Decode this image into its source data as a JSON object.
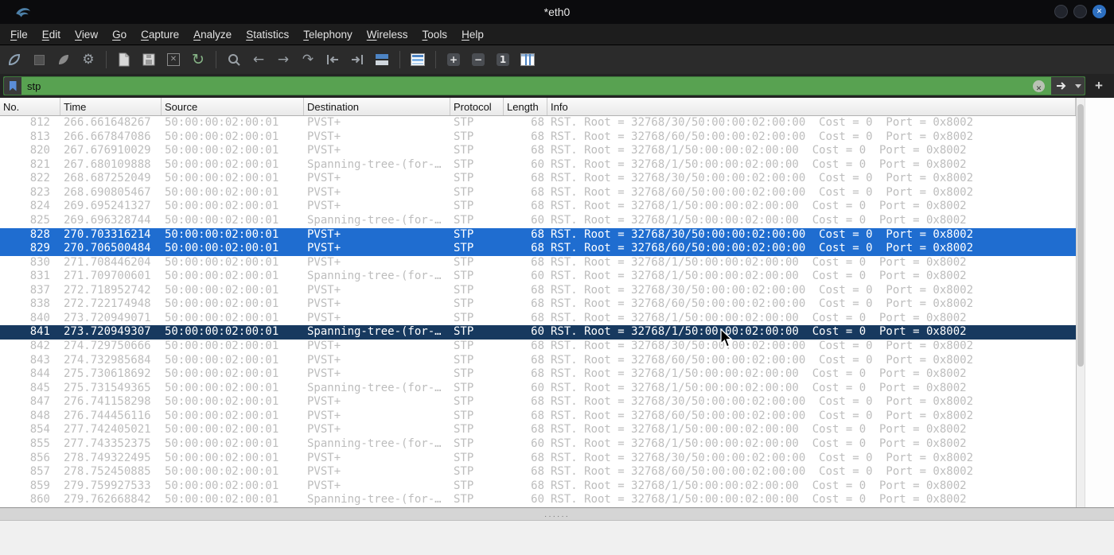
{
  "window": {
    "title": "*eth0"
  },
  "menubar": {
    "items": [
      "File",
      "Edit",
      "View",
      "Go",
      "Capture",
      "Analyze",
      "Statistics",
      "Telephony",
      "Wireless",
      "Tools",
      "Help"
    ]
  },
  "toolbar": {
    "groups": [
      [
        "wireshark-fin",
        "stop-capture",
        "restart-capture",
        "capture-options"
      ],
      [
        "open-file",
        "save-file",
        "close-file",
        "reload-file"
      ],
      [
        "find-packet",
        "go-back",
        "go-forward",
        "go-to-packet",
        "go-first",
        "go-last",
        "auto-scroll"
      ],
      [
        "colorize"
      ],
      [
        "zoom-in",
        "zoom-out",
        "zoom-100",
        "resize-columns"
      ]
    ]
  },
  "filter": {
    "value": "stp",
    "add_label": "+"
  },
  "colors": {
    "filter_valid_green": "#58a251",
    "row_highlight_blue": "#1f6dd0",
    "row_selected_navy": "#17395f",
    "row_text_gray": "#bdbdbd"
  },
  "table": {
    "columns": [
      "No.",
      "Time",
      "Source",
      "Destination",
      "Protocol",
      "Length",
      "Info"
    ],
    "rows": [
      {
        "no": "812",
        "time": "266.661648267",
        "src": "50:00:00:02:00:01",
        "dst": "PVST+",
        "proto": "STP",
        "len": "68",
        "info": "RST. Root = 32768/30/50:00:00:02:00:00  Cost = 0  Port = 0x8002",
        "state": "normal"
      },
      {
        "no": "813",
        "time": "266.667847086",
        "src": "50:00:00:02:00:01",
        "dst": "PVST+",
        "proto": "STP",
        "len": "68",
        "info": "RST. Root = 32768/60/50:00:00:02:00:00  Cost = 0  Port = 0x8002",
        "state": "normal"
      },
      {
        "no": "820",
        "time": "267.676910029",
        "src": "50:00:00:02:00:01",
        "dst": "PVST+",
        "proto": "STP",
        "len": "68",
        "info": "RST. Root = 32768/1/50:00:00:02:00:00  Cost = 0  Port = 0x8002",
        "state": "normal"
      },
      {
        "no": "821",
        "time": "267.680109888",
        "src": "50:00:00:02:00:01",
        "dst": "Spanning-tree-(for-…",
        "proto": "STP",
        "len": "60",
        "info": "RST. Root = 32768/1/50:00:00:02:00:00  Cost = 0  Port = 0x8002",
        "state": "normal"
      },
      {
        "no": "822",
        "time": "268.687252049",
        "src": "50:00:00:02:00:01",
        "dst": "PVST+",
        "proto": "STP",
        "len": "68",
        "info": "RST. Root = 32768/30/50:00:00:02:00:00  Cost = 0  Port = 0x8002",
        "state": "normal"
      },
      {
        "no": "823",
        "time": "268.690805467",
        "src": "50:00:00:02:00:01",
        "dst": "PVST+",
        "proto": "STP",
        "len": "68",
        "info": "RST. Root = 32768/60/50:00:00:02:00:00  Cost = 0  Port = 0x8002",
        "state": "normal"
      },
      {
        "no": "824",
        "time": "269.695241327",
        "src": "50:00:00:02:00:01",
        "dst": "PVST+",
        "proto": "STP",
        "len": "68",
        "info": "RST. Root = 32768/1/50:00:00:02:00:00  Cost = 0  Port = 0x8002",
        "state": "normal"
      },
      {
        "no": "825",
        "time": "269.696328744",
        "src": "50:00:00:02:00:01",
        "dst": "Spanning-tree-(for-…",
        "proto": "STP",
        "len": "60",
        "info": "RST. Root = 32768/1/50:00:00:02:00:00  Cost = 0  Port = 0x8002",
        "state": "normal"
      },
      {
        "no": "828",
        "time": "270.703316214",
        "src": "50:00:00:02:00:01",
        "dst": "PVST+",
        "proto": "STP",
        "len": "68",
        "info": "RST. Root = 32768/30/50:00:00:02:00:00  Cost = 0  Port = 0x8002",
        "state": "highlight"
      },
      {
        "no": "829",
        "time": "270.706500484",
        "src": "50:00:00:02:00:01",
        "dst": "PVST+",
        "proto": "STP",
        "len": "68",
        "info": "RST. Root = 32768/60/50:00:00:02:00:00  Cost = 0  Port = 0x8002",
        "state": "highlight"
      },
      {
        "no": "830",
        "time": "271.708446204",
        "src": "50:00:00:02:00:01",
        "dst": "PVST+",
        "proto": "STP",
        "len": "68",
        "info": "RST. Root = 32768/1/50:00:00:02:00:00  Cost = 0  Port = 0x8002",
        "state": "normal"
      },
      {
        "no": "831",
        "time": "271.709700601",
        "src": "50:00:00:02:00:01",
        "dst": "Spanning-tree-(for-…",
        "proto": "STP",
        "len": "60",
        "info": "RST. Root = 32768/1/50:00:00:02:00:00  Cost = 0  Port = 0x8002",
        "state": "normal"
      },
      {
        "no": "837",
        "time": "272.718952742",
        "src": "50:00:00:02:00:01",
        "dst": "PVST+",
        "proto": "STP",
        "len": "68",
        "info": "RST. Root = 32768/30/50:00:00:02:00:00  Cost = 0  Port = 0x8002",
        "state": "normal"
      },
      {
        "no": "838",
        "time": "272.722174948",
        "src": "50:00:00:02:00:01",
        "dst": "PVST+",
        "proto": "STP",
        "len": "68",
        "info": "RST. Root = 32768/60/50:00:00:02:00:00  Cost = 0  Port = 0x8002",
        "state": "normal"
      },
      {
        "no": "840",
        "time": "273.720949071",
        "src": "50:00:00:02:00:01",
        "dst": "PVST+",
        "proto": "STP",
        "len": "68",
        "info": "RST. Root = 32768/1/50:00:00:02:00:00  Cost = 0  Port = 0x8002",
        "state": "normal"
      },
      {
        "no": "841",
        "time": "273.720949307",
        "src": "50:00:00:02:00:01",
        "dst": "Spanning-tree-(for-…",
        "proto": "STP",
        "len": "60",
        "info": "RST. Root = 32768/1/50:00:00:02:00:00  Cost = 0  Port = 0x8002",
        "state": "selected"
      },
      {
        "no": "842",
        "time": "274.729750666",
        "src": "50:00:00:02:00:01",
        "dst": "PVST+",
        "proto": "STP",
        "len": "68",
        "info": "RST. Root = 32768/30/50:00:00:02:00:00  Cost = 0  Port = 0x8002",
        "state": "normal"
      },
      {
        "no": "843",
        "time": "274.732985684",
        "src": "50:00:00:02:00:01",
        "dst": "PVST+",
        "proto": "STP",
        "len": "68",
        "info": "RST. Root = 32768/60/50:00:00:02:00:00  Cost = 0  Port = 0x8002",
        "state": "normal"
      },
      {
        "no": "844",
        "time": "275.730618692",
        "src": "50:00:00:02:00:01",
        "dst": "PVST+",
        "proto": "STP",
        "len": "68",
        "info": "RST. Root = 32768/1/50:00:00:02:00:00  Cost = 0  Port = 0x8002",
        "state": "normal"
      },
      {
        "no": "845",
        "time": "275.731549365",
        "src": "50:00:00:02:00:01",
        "dst": "Spanning-tree-(for-…",
        "proto": "STP",
        "len": "60",
        "info": "RST. Root = 32768/1/50:00:00:02:00:00  Cost = 0  Port = 0x8002",
        "state": "normal"
      },
      {
        "no": "847",
        "time": "276.741158298",
        "src": "50:00:00:02:00:01",
        "dst": "PVST+",
        "proto": "STP",
        "len": "68",
        "info": "RST. Root = 32768/30/50:00:00:02:00:00  Cost = 0  Port = 0x8002",
        "state": "normal"
      },
      {
        "no": "848",
        "time": "276.744456116",
        "src": "50:00:00:02:00:01",
        "dst": "PVST+",
        "proto": "STP",
        "len": "68",
        "info": "RST. Root = 32768/60/50:00:00:02:00:00  Cost = 0  Port = 0x8002",
        "state": "normal"
      },
      {
        "no": "854",
        "time": "277.742405021",
        "src": "50:00:00:02:00:01",
        "dst": "PVST+",
        "proto": "STP",
        "len": "68",
        "info": "RST. Root = 32768/1/50:00:00:02:00:00  Cost = 0  Port = 0x8002",
        "state": "normal"
      },
      {
        "no": "855",
        "time": "277.743352375",
        "src": "50:00:00:02:00:01",
        "dst": "Spanning-tree-(for-…",
        "proto": "STP",
        "len": "60",
        "info": "RST. Root = 32768/1/50:00:00:02:00:00  Cost = 0  Port = 0x8002",
        "state": "normal"
      },
      {
        "no": "856",
        "time": "278.749322495",
        "src": "50:00:00:02:00:01",
        "dst": "PVST+",
        "proto": "STP",
        "len": "68",
        "info": "RST. Root = 32768/30/50:00:00:02:00:00  Cost = 0  Port = 0x8002",
        "state": "normal"
      },
      {
        "no": "857",
        "time": "278.752450885",
        "src": "50:00:00:02:00:01",
        "dst": "PVST+",
        "proto": "STP",
        "len": "68",
        "info": "RST. Root = 32768/60/50:00:00:02:00:00  Cost = 0  Port = 0x8002",
        "state": "normal"
      },
      {
        "no": "859",
        "time": "279.759927533",
        "src": "50:00:00:02:00:01",
        "dst": "PVST+",
        "proto": "STP",
        "len": "68",
        "info": "RST. Root = 32768/1/50:00:00:02:00:00  Cost = 0  Port = 0x8002",
        "state": "normal"
      },
      {
        "no": "860",
        "time": "279.762668842",
        "src": "50:00:00:02:00:01",
        "dst": "Spanning-tree-(for-…",
        "proto": "STP",
        "len": "60",
        "info": "RST. Root = 32768/1/50:00:00:02:00:00  Cost = 0  Port = 0x8002",
        "state": "normal"
      }
    ]
  }
}
